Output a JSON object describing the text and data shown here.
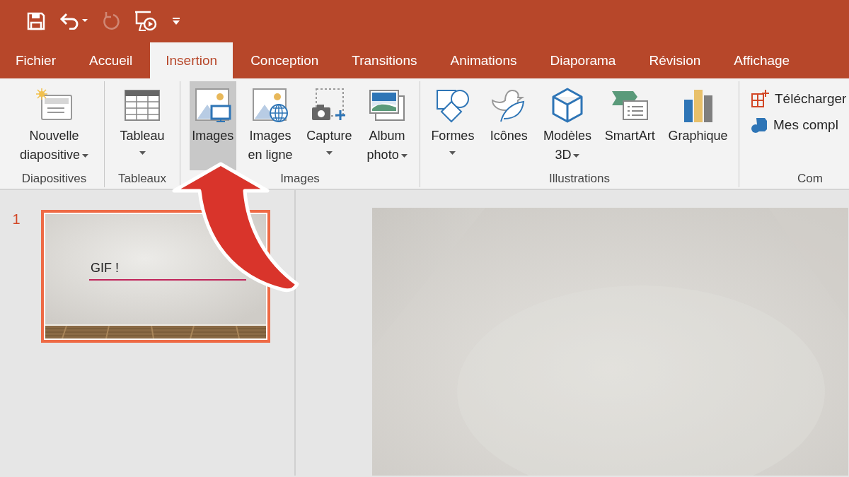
{
  "quick_access_toolbar": [
    {
      "disabled": false
    },
    {
      "disabled": false
    },
    {
      "disabled": true
    },
    {
      "disabled": false
    },
    {
      "disabled": false
    }
  ],
  "tabs": [
    {
      "label": "Fichier",
      "selected": false
    },
    {
      "label": "Accueil",
      "selected": false
    },
    {
      "label": "Insertion",
      "selected": true
    },
    {
      "label": "Conception",
      "selected": false
    },
    {
      "label": "Transitions",
      "selected": false
    },
    {
      "label": "Animations",
      "selected": false
    },
    {
      "label": "Diaporama",
      "selected": false
    },
    {
      "label": "Révision",
      "selected": false
    },
    {
      "label": "Affichage",
      "selected": false
    }
  ],
  "ribbon": {
    "groups": [
      {
        "label": "Diapositives",
        "buttons": [
          {
            "label": "Nouvelle\ndiapositive",
            "dropdown": true,
            "selected": false
          }
        ]
      },
      {
        "label": "Tableaux",
        "buttons": [
          {
            "label": "Tableau",
            "dropdown": true,
            "selected": false
          }
        ]
      },
      {
        "label": "Images",
        "buttons": [
          {
            "label": "Images",
            "dropdown": false,
            "selected": true
          },
          {
            "label": "Images\nen ligne",
            "dropdown": false,
            "selected": false
          },
          {
            "label": "Capture",
            "dropdown": true,
            "selected": false
          },
          {
            "label": "Album\nphoto",
            "dropdown": true,
            "selected": false
          }
        ]
      },
      {
        "label": "Illustrations",
        "buttons": [
          {
            "label": "Formes",
            "dropdown": true,
            "selected": false
          },
          {
            "label": "Icônes",
            "dropdown": false,
            "selected": false
          },
          {
            "label": "Modèles\n3D",
            "dropdown": true,
            "selected": false
          },
          {
            "label": "SmartArt",
            "dropdown": false,
            "selected": false
          },
          {
            "label": "Graphique",
            "dropdown": false,
            "selected": false
          }
        ]
      },
      {
        "label": "Com",
        "small_buttons": [
          {
            "label": "Télécharger"
          },
          {
            "label": "Mes compl"
          }
        ]
      }
    ]
  },
  "slides_pane": {
    "slides": [
      {
        "number": "1",
        "selected": true,
        "title": "GIF !"
      }
    ]
  }
}
